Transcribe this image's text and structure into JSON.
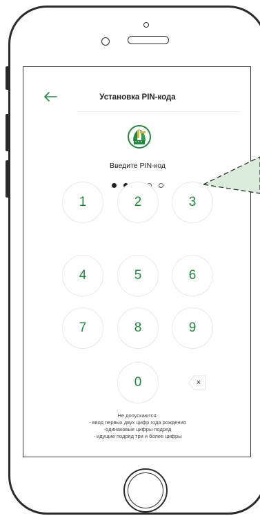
{
  "header": {
    "title": "Установка PIN-кода"
  },
  "prompt": "Введите PIN-код",
  "pin": {
    "length": 5,
    "entered": 2
  },
  "keypad": {
    "keys": [
      "1",
      "2",
      "3",
      "4",
      "5",
      "6",
      "7",
      "8",
      "9",
      "0"
    ],
    "delete_symbol": "×"
  },
  "rules": {
    "title": "Не допускаются:",
    "items": [
      "- ввод первых двух цифр года рождения",
      "-одинаковые цифры подряд",
      "- идущие подряд три и более цифры"
    ]
  },
  "colors": {
    "accent": "#1f8a3c",
    "callout_fill": "#d9ecd9"
  },
  "icons": {
    "back": "arrow-left-icon",
    "logo": "bank-logo-icon",
    "delete": "backspace-icon"
  }
}
